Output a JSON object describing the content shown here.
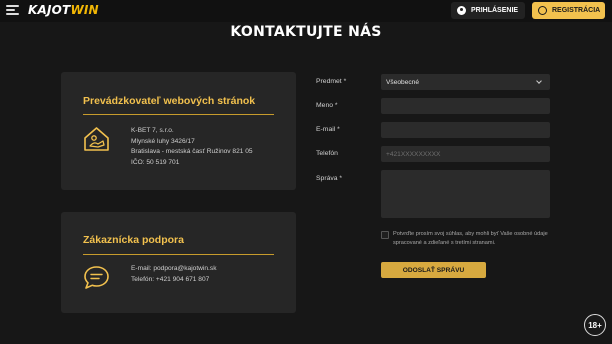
{
  "header": {
    "logo_main": "KAJOT",
    "logo_accent": "WIN",
    "login_label": "PRIHLÁSENIE",
    "register_label": "REGISTRÁCIA"
  },
  "page_title": "KONTAKTUJTE NÁS",
  "operator_card": {
    "title": "Prevádzkovateľ webových stránok",
    "lines": [
      "K-BET 7, s.r.o.",
      "Mlynské luhy 3426/17",
      "Bratislava - mestská časť Ružinov 821 05",
      "IČO: 50 519 701"
    ]
  },
  "support_card": {
    "title": "Zákaznícka podpora",
    "email_line": "E-mail: podpora@kajotwin.sk",
    "phone_line": "Telefón: +421 904 671 807"
  },
  "form": {
    "subject_label": "Predmet *",
    "subject_value": "Všeobecné",
    "name_label": "Meno *",
    "email_label": "E-mail *",
    "phone_label": "Telefón",
    "phone_placeholder": "+421XXXXXXXXX",
    "message_label": "Správa *",
    "consent_text": "Potvrďte prosím svoj súhlas, aby mohli byť Vaše osobné údaje spracované a zdieľané s tretími stranami.",
    "submit_label": "ODOSLAŤ SPRÁVU"
  },
  "age_badge": "18+",
  "colors": {
    "accent": "#f2c14e",
    "background": "#171717",
    "card": "#262626",
    "field": "#2b2b2b"
  }
}
